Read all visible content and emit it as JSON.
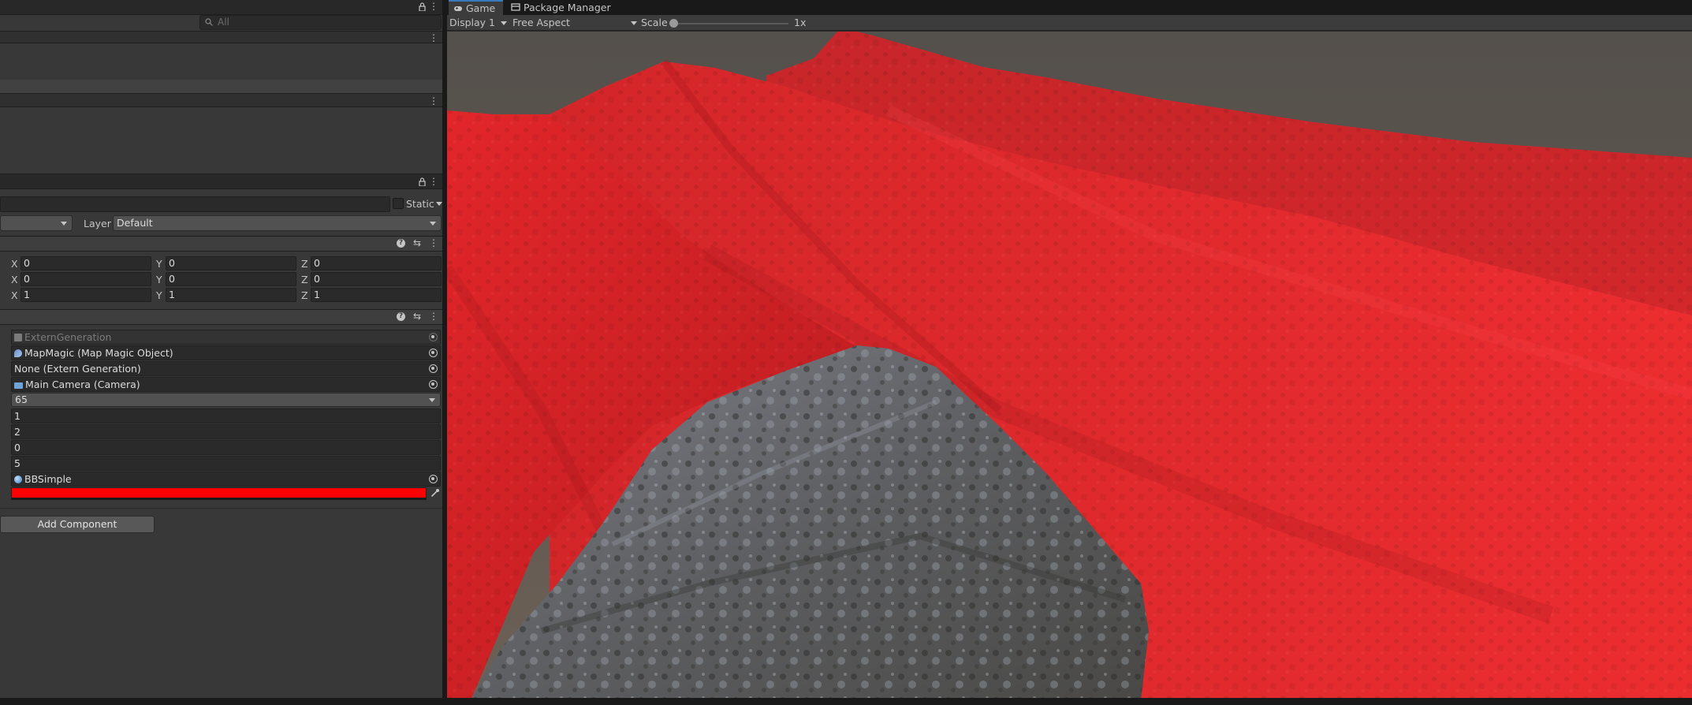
{
  "hierarchy": {
    "search_placeholder": "All"
  },
  "inspector": {
    "static_label": "Static",
    "layer_label": "Layer",
    "layer_value": "Default",
    "transform": {
      "position": {
        "x": "0",
        "y": "0",
        "z": "0"
      },
      "rotation": {
        "x": "0",
        "y": "0",
        "z": "0"
      },
      "scale": {
        "x": "1",
        "y": "1",
        "z": "1"
      }
    },
    "axis_labels": {
      "x": "X",
      "y": "Y",
      "z": "Z"
    },
    "script_fields": {
      "script": "ExternGeneration",
      "map_magic": "MapMagic (Map Magic Object)",
      "extern_generation": "None (Extern Generation)",
      "camera": "Main Camera (Camera)",
      "dropdown_value": "65",
      "value_1": "1",
      "value_2": "2",
      "value_3": "0",
      "value_4": "5",
      "material": "BBSimple",
      "color": "#ff0000"
    },
    "add_component_label": "Add Component"
  },
  "game_view": {
    "tabs": [
      {
        "label": "Game",
        "icon": "gamepad-icon",
        "active": true
      },
      {
        "label": "Package Manager",
        "icon": "package-icon",
        "active": false
      }
    ],
    "display": "Display 1",
    "aspect": "Free Aspect",
    "scale_label": "Scale",
    "scale_value": "1x",
    "scale_level": 0.0
  },
  "colors": {
    "terrain_red": "#e8272a",
    "panel_bg": "#383838",
    "header_bg": "#282828",
    "field_bg": "#2a2a2a",
    "accent_blue": "#3a79bb"
  }
}
